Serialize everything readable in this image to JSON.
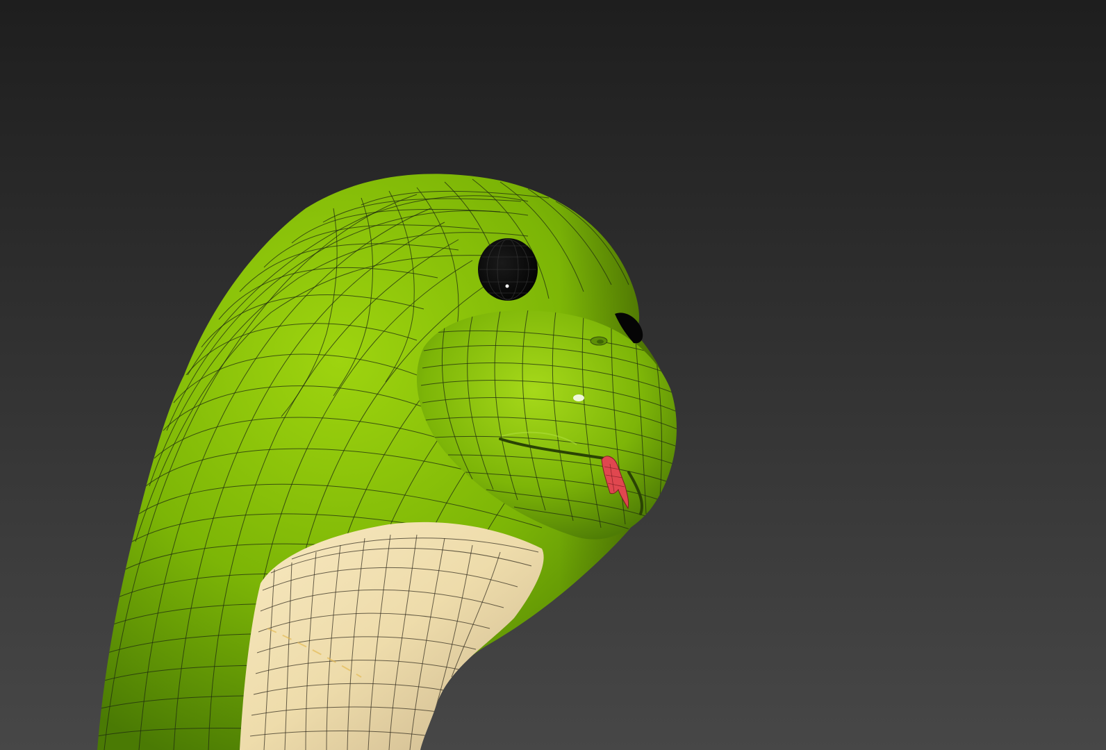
{
  "viewport": {
    "background_top": "#1e1e1e",
    "background_bottom": "#474747"
  },
  "model": {
    "colors": {
      "skin_light": "#9ed40f",
      "skin_mid": "#7cb506",
      "skin_dark": "#4a7a04",
      "belly_light": "#f7e8bf",
      "belly_dark": "#c9b48c",
      "eye": "#050505",
      "tongue": "#e0474f",
      "wire": "#1e2a10"
    },
    "parts": {
      "eye_left": "eye-icon",
      "eye_right": "eye-icon",
      "tongue": "tongue-icon"
    }
  }
}
